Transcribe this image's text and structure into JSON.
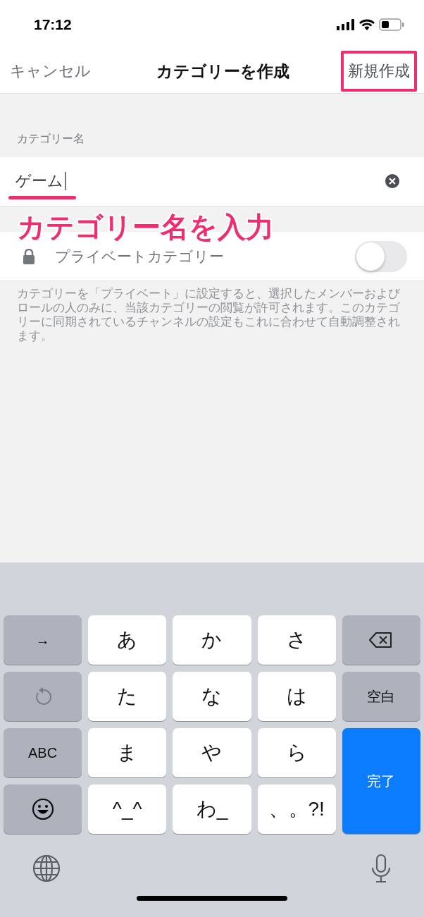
{
  "status_bar": {
    "time": "17:12"
  },
  "nav": {
    "cancel": "キャンセル",
    "title": "カテゴリーを作成",
    "create": "新規作成",
    "create_highlighted": true
  },
  "field": {
    "label": "カテゴリー名",
    "value": "ゲーム",
    "underlined": true
  },
  "annotation": {
    "text": "カテゴリー名を入力"
  },
  "private_toggle": {
    "label": "プライベートカテゴリー",
    "on": false
  },
  "description": "カテゴリーを「プライベート」に設定すると、選択したメンバーおよびロールの人のみに、当該カテゴリーの閲覧が許可されます。このカテゴリーに同期されているチャンネルの設定もこれに合わせて自動調整されます。",
  "keyboard": {
    "keys": [
      {
        "kind": "text",
        "dark": true,
        "label": "→"
      },
      {
        "kind": "text",
        "dark": false,
        "label": "あ"
      },
      {
        "kind": "text",
        "dark": false,
        "label": "か"
      },
      {
        "kind": "text",
        "dark": false,
        "label": "さ"
      },
      {
        "kind": "backspace",
        "dark": true
      },
      {
        "kind": "undo",
        "dark": true
      },
      {
        "kind": "text",
        "dark": false,
        "label": "た"
      },
      {
        "kind": "text",
        "dark": false,
        "label": "な"
      },
      {
        "kind": "text",
        "dark": false,
        "label": "は"
      },
      {
        "kind": "text",
        "dark": true,
        "label": "空白"
      },
      {
        "kind": "text",
        "dark": true,
        "label": "ABC"
      },
      {
        "kind": "text",
        "dark": false,
        "label": "ま"
      },
      {
        "kind": "text",
        "dark": false,
        "label": "や"
      },
      {
        "kind": "text",
        "dark": false,
        "label": "ら"
      },
      {
        "kind": "done",
        "label": "完了"
      },
      {
        "kind": "emoji",
        "dark": true
      },
      {
        "kind": "text",
        "dark": false,
        "label": "^_^"
      },
      {
        "kind": "text",
        "dark": false,
        "label": "わ_"
      },
      {
        "kind": "text",
        "dark": false,
        "label": "、。?!"
      }
    ]
  }
}
